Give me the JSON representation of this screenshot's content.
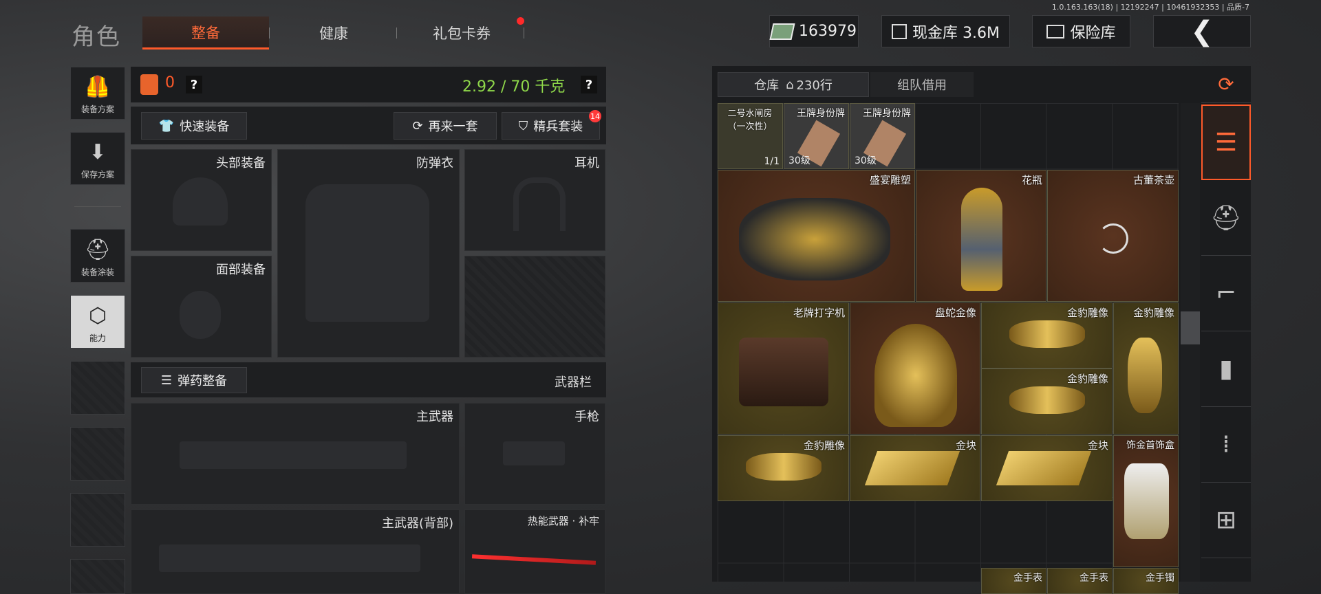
{
  "version": "1.0.163.163(18) | 12192247 | 10461932353 | 品质-7",
  "header": {
    "role_title": "角色",
    "tabs": [
      {
        "label": "整备"
      },
      {
        "label": "健康"
      },
      {
        "label": "礼包卡券"
      }
    ],
    "money": "163979",
    "cash_vault": "现金库 3.6M",
    "safe_box": "保险库",
    "back_icon": "chevron-left-icon"
  },
  "sidebar": {
    "items": [
      {
        "label": "装备方案",
        "icon": "vest-icon"
      },
      {
        "label": "保存方案",
        "icon": "download-icon"
      },
      {
        "label": "装备涂装",
        "icon": "helmet-paint-icon"
      },
      {
        "label": "能力",
        "icon": "lightning-hex-icon"
      }
    ]
  },
  "equip": {
    "armor_count": "0",
    "weight": "2.92 / 70 千克",
    "help": "?",
    "quick_equip": "快速装备",
    "again": "再来一套",
    "elite_set": "精兵套装",
    "elite_badge": "14",
    "slots": {
      "head": "头部装备",
      "armor": "防弹衣",
      "headset": "耳机",
      "face": "面部装备"
    },
    "ammo_btn": "弹药整备",
    "weapon_bar": "武器栏",
    "primary": "主武器",
    "pistol": "手枪",
    "primary_back": "主武器(背部)",
    "melee": "热能武器 · 补牢"
  },
  "storage": {
    "tabs": [
      {
        "label": "仓库",
        "count": "230行"
      },
      {
        "label": "组队借用"
      }
    ],
    "items": [
      {
        "name": "二号水闸房（一次性）",
        "sub": "1/1"
      },
      {
        "name": "王牌身份牌",
        "sub": "30级"
      },
      {
        "name": "王牌身份牌",
        "sub": "30级"
      },
      {
        "name": "盛宴雕塑"
      },
      {
        "name": "花瓶"
      },
      {
        "name": "古董茶壶"
      },
      {
        "name": "老牌打字机"
      },
      {
        "name": "盘蛇金像"
      },
      {
        "name": "金豹雕像"
      },
      {
        "name": "金豹雕像"
      },
      {
        "name": "金豹雕像"
      },
      {
        "name": "金豹雕像"
      },
      {
        "name": "金块"
      },
      {
        "name": "金块"
      },
      {
        "name": "饰金首饰盒"
      },
      {
        "name": "金手表"
      },
      {
        "name": "金手表"
      },
      {
        "name": "金手镯"
      }
    ]
  },
  "colors": {
    "accent": "#ff5a2a",
    "weight": "#8fd84a",
    "red_item": "#5a3420",
    "gold_item": "#55491e"
  }
}
